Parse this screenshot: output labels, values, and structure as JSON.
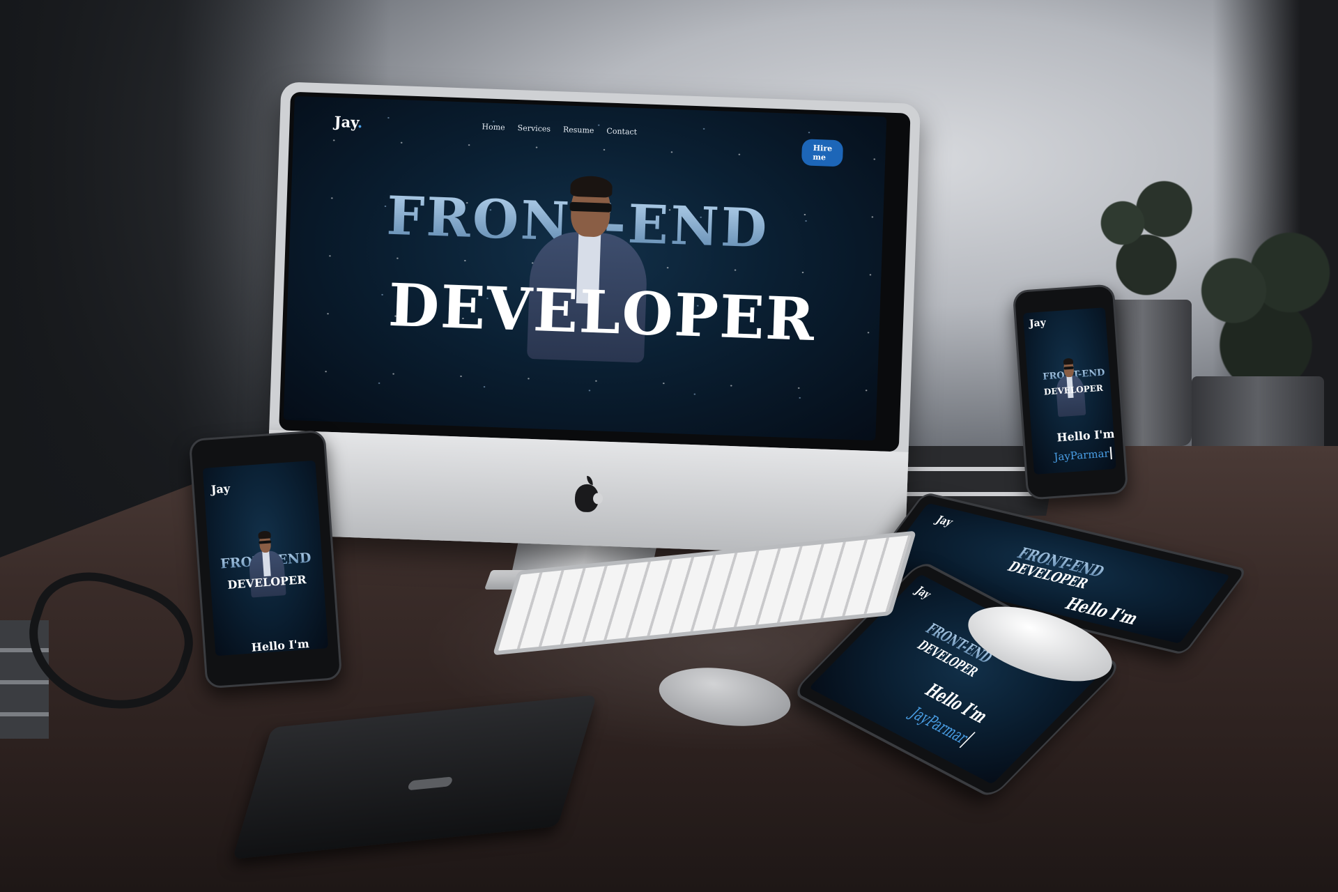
{
  "site": {
    "brand": "Jay",
    "brand_dot": ".",
    "nav": [
      "Home",
      "Services",
      "Resume",
      "Contact"
    ],
    "cta": "Hire me",
    "headline_line1": "FRONT-END",
    "headline_line2": "DEVELOPER",
    "greeting": "Hello I'm",
    "name": "JayParmar"
  },
  "colors": {
    "accent": "#1d66b8",
    "name_color": "#4a9fe6",
    "screen_bg": "#0a1f32"
  },
  "icons": [
    "apple-logo-icon"
  ]
}
